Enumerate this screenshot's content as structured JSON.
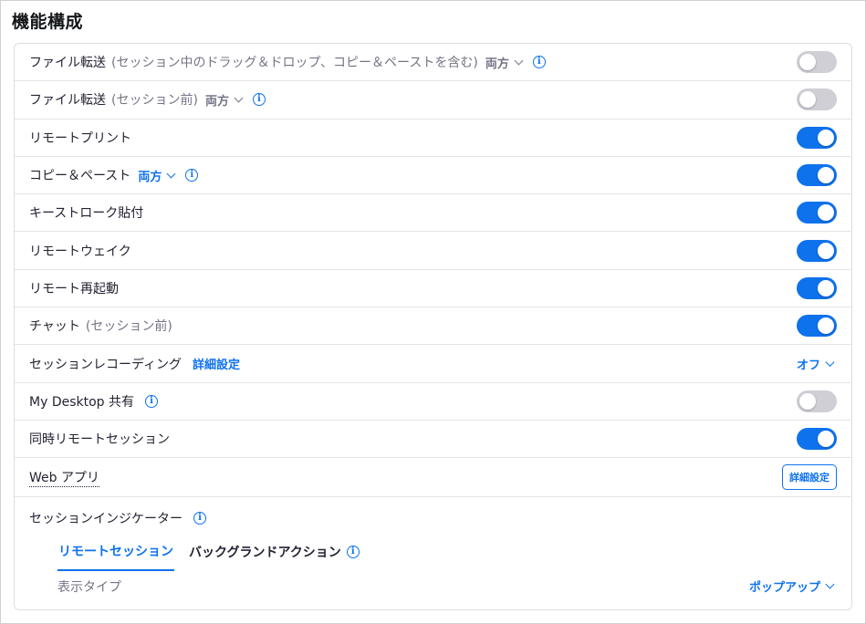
{
  "page": {
    "title": "機能構成"
  },
  "colors": {
    "accent": "#0e72ed",
    "toggle_off": "#cfcfd5"
  },
  "rows": [
    {
      "label": "ファイル転送",
      "sub": "(セッション中のドラッグ＆ドロップ、コピー＆ペーストを含む)",
      "dropdown": "両方",
      "dropdown_active": false,
      "info": "info-icon",
      "toggle_on": false
    },
    {
      "label": "ファイル転送",
      "sub": "(セッション前)",
      "dropdown": "両方",
      "dropdown_active": false,
      "info": "info-icon",
      "toggle_on": false
    },
    {
      "label": "リモートプリント",
      "toggle_on": true
    },
    {
      "label": "コピー＆ペースト",
      "dropdown": "両方",
      "dropdown_active": true,
      "info": "info-icon",
      "toggle_on": true
    },
    {
      "label": "キーストローク貼付",
      "toggle_on": true
    },
    {
      "label": "リモートウェイク",
      "toggle_on": true
    },
    {
      "label": "リモート再起動",
      "toggle_on": true
    },
    {
      "label": "チャット",
      "sub": "(セッション前)",
      "toggle_on": true
    }
  ],
  "session_recording": {
    "label": "セッションレコーディング",
    "link": "詳細設定",
    "value": "オフ"
  },
  "my_desktop": {
    "label": "My Desktop 共有",
    "info": "info-icon",
    "toggle_on": false
  },
  "concurrent": {
    "label": "同時リモートセッション",
    "toggle_on": true
  },
  "web_app": {
    "label": "Web アプリ",
    "button": "詳細設定"
  },
  "session_indicator": {
    "label": "セッションインジケーター",
    "info": "info-icon",
    "tabs": [
      {
        "label": "リモートセッション",
        "active": true
      },
      {
        "label": "バックグランドアクション",
        "active": false,
        "info": "info-icon"
      }
    ],
    "display_type_label": "表示タイプ",
    "display_type_value": "ポップアップ"
  }
}
